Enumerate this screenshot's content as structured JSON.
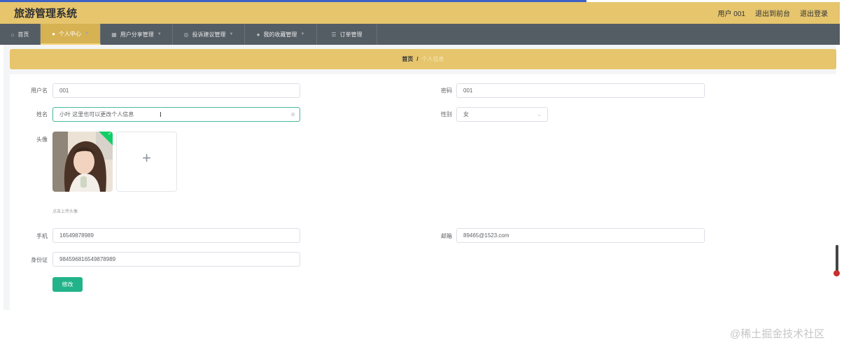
{
  "app": {
    "title": "旅游管理系统",
    "header_links": [
      "用户 001",
      "退出到前台",
      "退出登录"
    ]
  },
  "nav": {
    "items": [
      {
        "label": "首页",
        "icon": "home-icon",
        "has_dropdown": false,
        "active": false
      },
      {
        "label": "个人中心",
        "icon": "user-icon",
        "has_dropdown": true,
        "active": true
      },
      {
        "label": "用户分享管理",
        "icon": "grid-icon",
        "has_dropdown": true,
        "active": false
      },
      {
        "label": "投诉建议管理",
        "icon": "chat-icon",
        "has_dropdown": true,
        "active": false
      },
      {
        "label": "我的收藏管理",
        "icon": "user-icon",
        "has_dropdown": true,
        "active": false
      },
      {
        "label": "订单管理",
        "icon": "list-icon",
        "has_dropdown": false,
        "active": false
      }
    ]
  },
  "breadcrumb": {
    "home": "首页",
    "separator": "/",
    "current": "个人信息"
  },
  "form": {
    "username": {
      "label": "用户名",
      "value": "001"
    },
    "password": {
      "label": "密码",
      "value": "001"
    },
    "name": {
      "label": "姓名",
      "value": "小叶 这里也可以更改个人信息"
    },
    "gender": {
      "label": "性别",
      "value": "女"
    },
    "avatar": {
      "label": "头像",
      "hint": "点击上传头像"
    },
    "phone": {
      "label": "手机",
      "value": "16549878989"
    },
    "email": {
      "label": "邮箱",
      "value": "89465@1523.com"
    },
    "id_card": {
      "label": "身份证",
      "value": "984596816549878989"
    },
    "submit_label": "修改"
  },
  "colors": {
    "header_bg": "#e6c56d",
    "nav_bg": "#545c64",
    "nav_active_bg": "#d7b253",
    "button_bg": "#22b38a",
    "focus_border": "#47b89a"
  },
  "watermark": "@稀土掘金技术社区"
}
